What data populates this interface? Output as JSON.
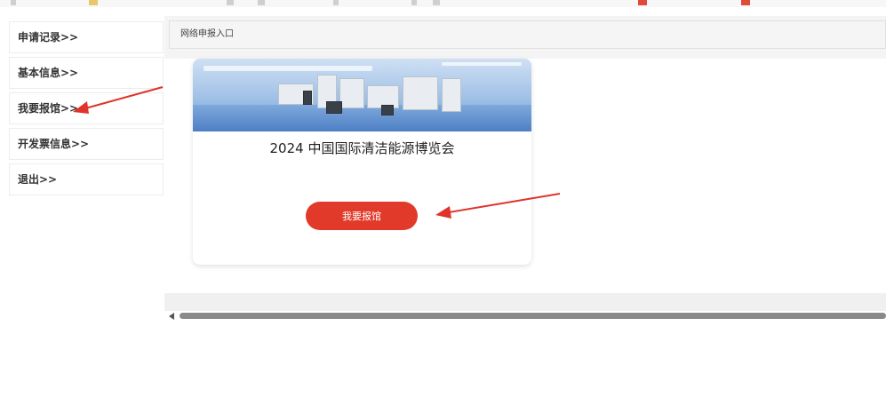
{
  "sidebar": {
    "items": [
      {
        "label": "申请记录>>"
      },
      {
        "label": "基本信息>>"
      },
      {
        "label": "我要报馆>>"
      },
      {
        "label": "开发票信息>>"
      },
      {
        "label": "退出>>"
      }
    ]
  },
  "main": {
    "breadcrumb": "网络申报入口",
    "card": {
      "title": "2024 中国国际清洁能源博览会",
      "button_label": "我要报馆"
    }
  },
  "colors": {
    "accent_button": "#e23a2a",
    "annotation_arrow": "#e0342a"
  },
  "icons": [
    "scroll-left-arrow-icon"
  ]
}
